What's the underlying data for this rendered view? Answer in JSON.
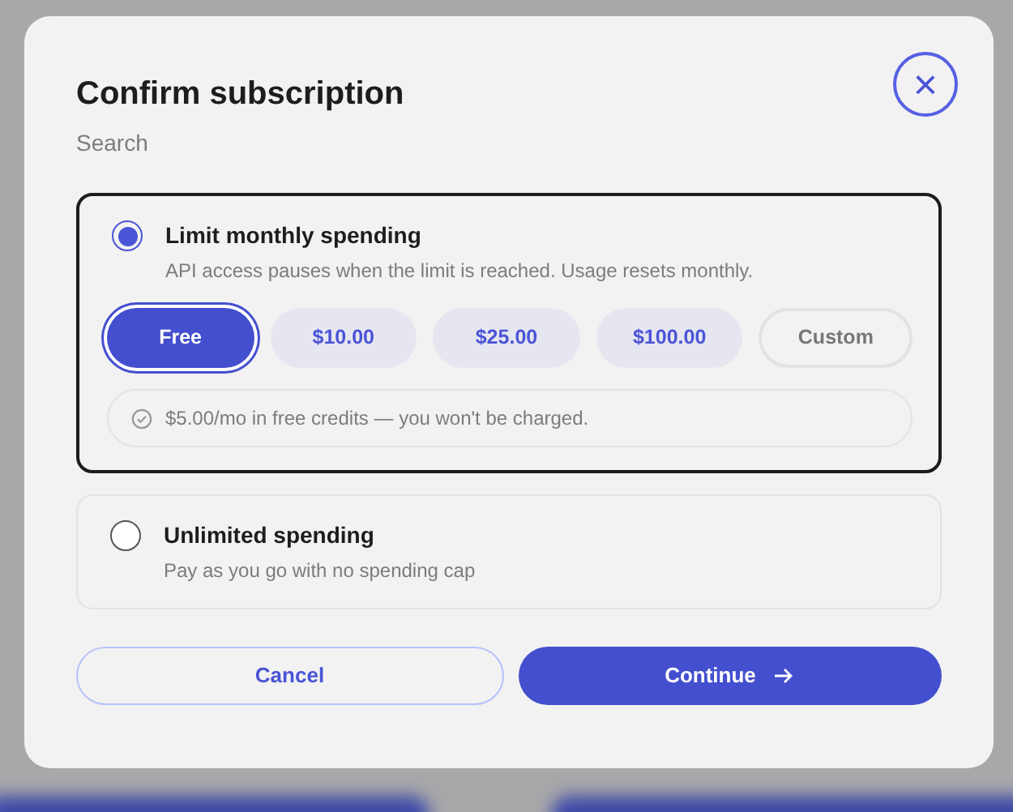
{
  "dialog": {
    "title": "Confirm subscription",
    "subtitle": "Search",
    "close_icon": "×"
  },
  "options": [
    {
      "label": "Limit monthly spending",
      "description": "API access pauses when the limit is reached. Usage resets monthly.",
      "selected": true,
      "amounts": [
        {
          "label": "Free",
          "kind": "preset",
          "selected": true
        },
        {
          "label": "$10.00",
          "kind": "preset",
          "selected": false
        },
        {
          "label": "$25.00",
          "kind": "preset",
          "selected": false
        },
        {
          "label": "$100.00",
          "kind": "preset",
          "selected": false
        },
        {
          "label": "Custom",
          "kind": "custom",
          "selected": false
        }
      ],
      "note": "$5.00/mo in free credits — you won't be charged."
    },
    {
      "label": "Unlimited spending",
      "description": "Pay as you go with no spending cap",
      "selected": false
    }
  ],
  "buttons": [
    {
      "label": "Cancel",
      "kind": "secondary"
    },
    {
      "label": "Continue",
      "kind": "primary"
    }
  ]
}
